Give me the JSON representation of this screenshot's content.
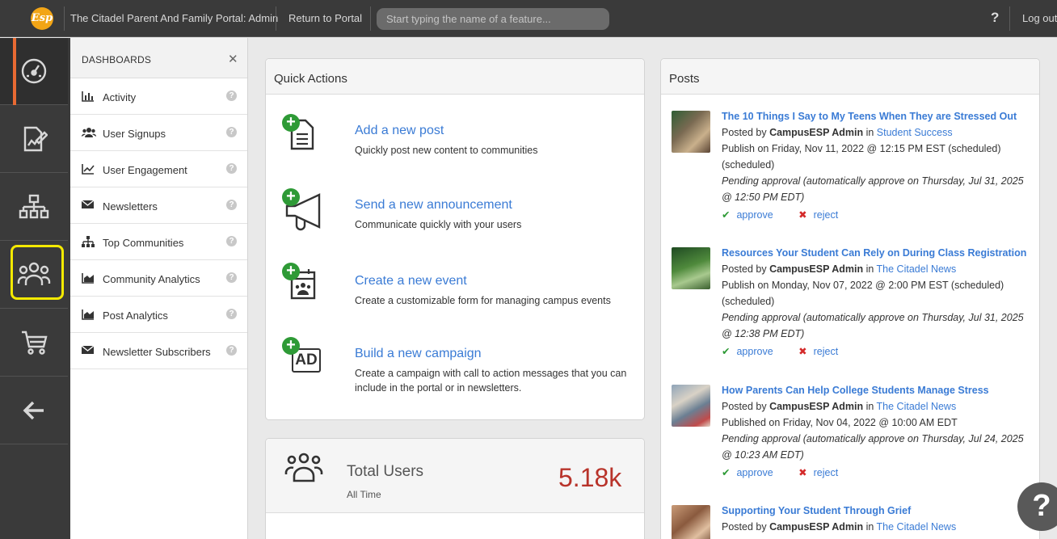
{
  "topbar": {
    "logo_text": "Esp",
    "portal_title": "The Citadel Parent And Family Portal: Admin",
    "return_label": "Return to Portal",
    "search_placeholder": "Start typing the name of a feature...",
    "help_label": "?",
    "logout_label": "Log out"
  },
  "rail": {
    "items": [
      {
        "icon": "dashboard-gauge-icon",
        "active": true
      },
      {
        "icon": "edit-document-icon"
      },
      {
        "icon": "sitemap-icon"
      },
      {
        "icon": "users-group-icon",
        "highlighted": true
      },
      {
        "icon": "cart-icon"
      },
      {
        "icon": "arrow-left-icon"
      }
    ],
    "accent_color": "#e86a33",
    "highlight_color": "#f5ea00"
  },
  "dashboards": {
    "title": "DASHBOARDS",
    "close_label": "✕",
    "help_glyph": "?",
    "items": [
      {
        "label": "Activity",
        "icon": "bar-chart-icon"
      },
      {
        "label": "User Signups",
        "icon": "users-icon"
      },
      {
        "label": "User Engagement",
        "icon": "line-chart-icon"
      },
      {
        "label": "Newsletters",
        "icon": "envelope-icon"
      },
      {
        "label": "Top Communities",
        "icon": "sitemap-icon"
      },
      {
        "label": "Community Analytics",
        "icon": "area-chart-icon"
      },
      {
        "label": "Post Analytics",
        "icon": "area-chart-icon"
      },
      {
        "label": "Newsletter Subscribers",
        "icon": "envelope-icon"
      }
    ]
  },
  "quick_actions": {
    "title": "Quick Actions",
    "plus_glyph": "+",
    "badge_ad": "AD",
    "items": [
      {
        "title": "Add a new post",
        "desc": "Quickly post new content to communities",
        "icon": "document-icon"
      },
      {
        "title": "Send a new announcement",
        "desc": "Communicate quickly with your users",
        "icon": "megaphone-icon"
      },
      {
        "title": "Create a new event",
        "desc": "Create a customizable form for managing campus events",
        "icon": "calendar-users-icon"
      },
      {
        "title": "Build a new campaign",
        "desc": "Create a campaign with call to action messages that you can include in the portal or in newsletters.",
        "icon": "ad-icon"
      }
    ]
  },
  "total_users": {
    "label": "Total Users",
    "sub": "All Time",
    "value": "5.18k",
    "icon": "users-group-icon"
  },
  "posts": {
    "title": "Posts",
    "approve_label": "approve",
    "reject_label": "reject",
    "check_glyph": "✔",
    "x_glyph": "✖",
    "items": [
      {
        "title": "The 10 Things I Say to My Teens When They are Stressed Out",
        "posted_prefix": "Posted by",
        "author": "CampusESP Admin",
        "in_word": "in",
        "community": "Student Success",
        "publish": "Publish on Friday, Nov 11, 2022 @ 12:15 PM EST (scheduled)",
        "scheduled": "(scheduled)",
        "pending_1": "Pending approval (automatically approve on Thursday, Jul 31, 2025",
        "pending_2": "@ 12:50 PM EDT)"
      },
      {
        "title": "Resources Your Student Can Rely on During Class Registration",
        "posted_prefix": "Posted by",
        "author": "CampusESP Admin",
        "in_word": "in",
        "community": "The Citadel News",
        "publish": "Publish on Monday, Nov 07, 2022 @ 2:00 PM EST (scheduled)",
        "scheduled": "(scheduled)",
        "pending_1": "Pending approval (automatically approve on Thursday, Jul 31, 2025",
        "pending_2": "@ 12:38 PM EDT)"
      },
      {
        "title": "How Parents Can Help College Students Manage Stress",
        "posted_prefix": "Posted by",
        "author": "CampusESP Admin",
        "in_word": "in",
        "community": "The Citadel News",
        "publish": "Published on Friday, Nov 04, 2022 @ 10:00 AM EDT",
        "pending_1": "Pending approval (automatically approve on Thursday, Jul 24, 2025",
        "pending_2": "@ 10:23 AM EDT)"
      },
      {
        "title": "Supporting Your Student Through Grief",
        "posted_prefix": "Posted by",
        "author": "CampusESP Admin",
        "in_word": "in",
        "community": "The Citadel News"
      }
    ]
  },
  "fab_label": "?"
}
